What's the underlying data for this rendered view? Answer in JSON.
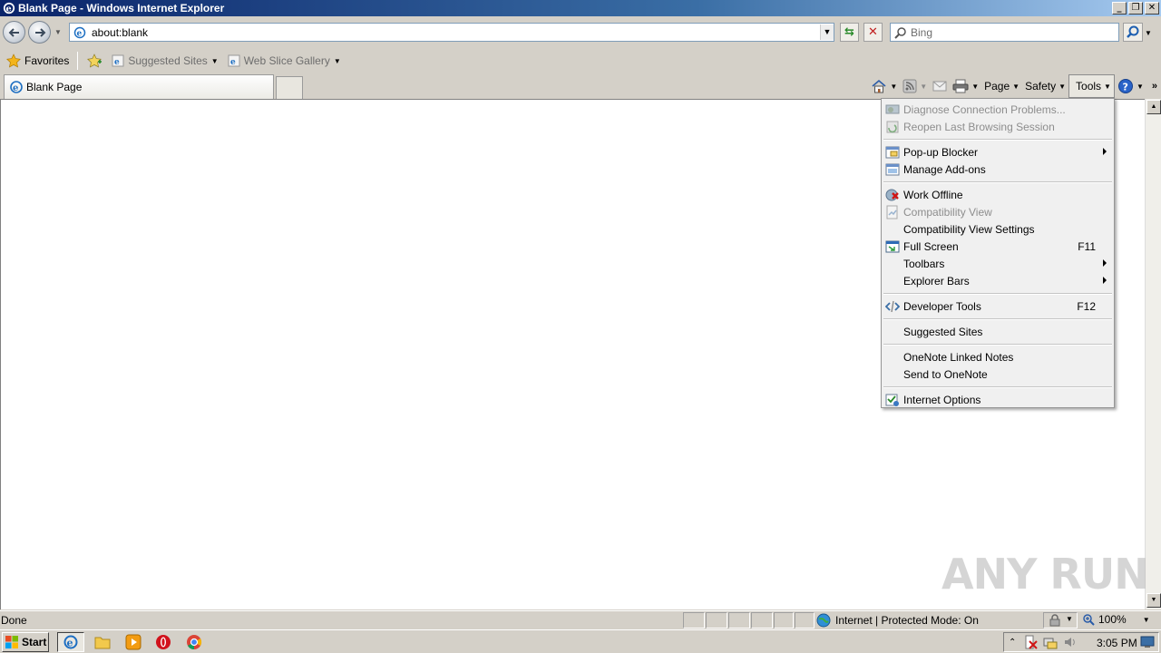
{
  "window": {
    "title": "Blank Page - Windows Internet Explorer",
    "controls": [
      "minimize",
      "restore",
      "close"
    ]
  },
  "address": {
    "url": "about:blank"
  },
  "search": {
    "placeholder": "Bing"
  },
  "favorites_bar": {
    "favorites_label": "Favorites",
    "items": [
      {
        "label": "Suggested Sites",
        "icon": "ie-page-icon"
      },
      {
        "label": "Web Slice Gallery",
        "icon": "ie-page-icon"
      }
    ]
  },
  "tabs": [
    {
      "label": "Blank Page"
    }
  ],
  "command_bar": {
    "page_label": "Page",
    "safety_label": "Safety",
    "tools_label": "Tools"
  },
  "tools_menu": {
    "items": [
      {
        "label": "Diagnose Connection Problems...",
        "disabled": true,
        "icon": "diagnose-icon"
      },
      {
        "label": "Reopen Last Browsing Session",
        "disabled": true,
        "icon": "reopen-icon"
      },
      {
        "label": "Pop-up Blocker",
        "submenu": true,
        "icon": "popup-blocker-icon"
      },
      {
        "label": "Manage Add-ons",
        "icon": "addons-icon"
      },
      {
        "label": "Work Offline",
        "icon": "work-offline-icon"
      },
      {
        "label": "Compatibility View",
        "disabled": true,
        "icon": "compat-view-icon"
      },
      {
        "label": "Compatibility View Settings"
      },
      {
        "label": "Full Screen",
        "shortcut": "F11",
        "icon": "fullscreen-icon"
      },
      {
        "label": "Toolbars",
        "submenu": true
      },
      {
        "label": "Explorer Bars",
        "submenu": true
      },
      {
        "label": "Developer Tools",
        "shortcut": "F12",
        "icon": "developer-tools-icon"
      },
      {
        "label": "Suggested Sites"
      },
      {
        "label": "OneNote Linked Notes"
      },
      {
        "label": "Send to OneNote"
      },
      {
        "label": "Internet Options",
        "icon": "internet-options-icon"
      }
    ]
  },
  "watermark": {
    "text": "ANY RUN"
  },
  "status_bar": {
    "status": "Done",
    "zone": "Internet | Protected Mode: On",
    "zoom": "100%"
  },
  "taskbar": {
    "start_label": "Start",
    "apps": [
      "internet-explorer",
      "file-explorer",
      "media-player",
      "opera",
      "chrome"
    ],
    "clock": "3:05 PM"
  }
}
